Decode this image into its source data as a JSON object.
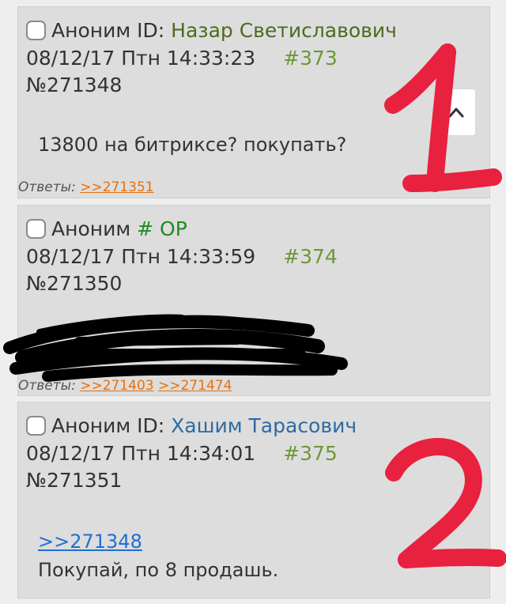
{
  "posts": [
    {
      "name": "Аноним",
      "id_prefix": "ID:",
      "poster_id": "Назар Светиславович",
      "datetime": "08/12/17 Птн 14:33:23",
      "index": "#373",
      "number": "№271348",
      "message": "13800 на битриксе? покупать?",
      "replies_label": "Ответы:",
      "replies": [
        ">>271351"
      ]
    },
    {
      "name": "Аноним",
      "tripcode": "# OP",
      "datetime": "08/12/17 Птн 14:33:59",
      "index": "#374",
      "number": "№271350",
      "replies_label": "Ответы:",
      "replies": [
        ">>271403",
        ">>271474"
      ]
    },
    {
      "name": "Аноним",
      "id_prefix": "ID:",
      "poster_id": "Хашим Тарасович",
      "datetime": "08/12/17 Птн 14:34:01",
      "index": "#375",
      "number": "№271351",
      "reply_to": ">>271348",
      "message": "Покупай, по 8 продашь."
    }
  ],
  "annotations": [
    "1",
    "2"
  ],
  "colors": {
    "post_bg": "#dddddd",
    "page_bg": "#eeeeee",
    "index_green": "#6e9838",
    "reply_orange": "#e6700e",
    "link_blue": "#1f6fd1",
    "annotation_red": "#e8213f"
  },
  "icons": {
    "scroll_up": "chevron-up-icon"
  }
}
